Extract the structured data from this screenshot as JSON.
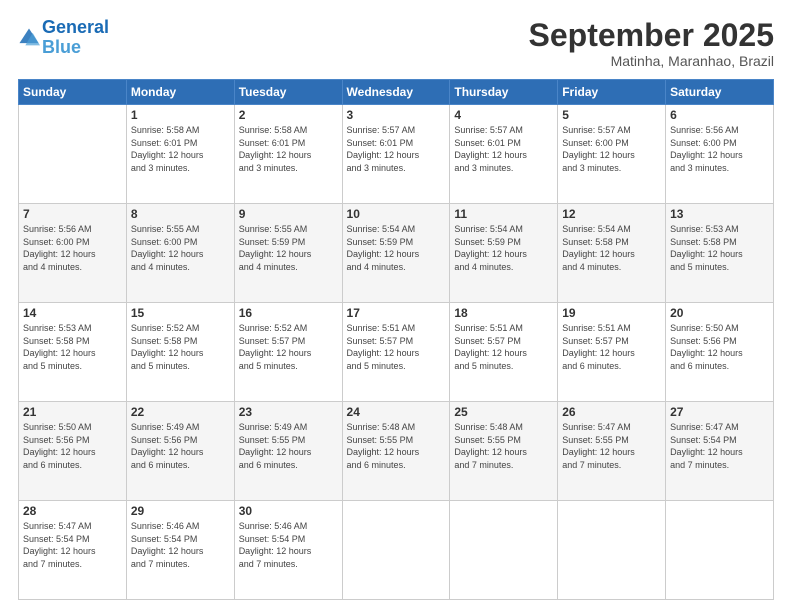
{
  "header": {
    "logo_line1": "General",
    "logo_line2": "Blue",
    "month": "September 2025",
    "location": "Matinha, Maranhao, Brazil"
  },
  "days_of_week": [
    "Sunday",
    "Monday",
    "Tuesday",
    "Wednesday",
    "Thursday",
    "Friday",
    "Saturday"
  ],
  "weeks": [
    [
      {
        "day": "",
        "info": ""
      },
      {
        "day": "1",
        "info": "Sunrise: 5:58 AM\nSunset: 6:01 PM\nDaylight: 12 hours\nand 3 minutes."
      },
      {
        "day": "2",
        "info": "Sunrise: 5:58 AM\nSunset: 6:01 PM\nDaylight: 12 hours\nand 3 minutes."
      },
      {
        "day": "3",
        "info": "Sunrise: 5:57 AM\nSunset: 6:01 PM\nDaylight: 12 hours\nand 3 minutes."
      },
      {
        "day": "4",
        "info": "Sunrise: 5:57 AM\nSunset: 6:01 PM\nDaylight: 12 hours\nand 3 minutes."
      },
      {
        "day": "5",
        "info": "Sunrise: 5:57 AM\nSunset: 6:00 PM\nDaylight: 12 hours\nand 3 minutes."
      },
      {
        "day": "6",
        "info": "Sunrise: 5:56 AM\nSunset: 6:00 PM\nDaylight: 12 hours\nand 3 minutes."
      }
    ],
    [
      {
        "day": "7",
        "info": "Sunrise: 5:56 AM\nSunset: 6:00 PM\nDaylight: 12 hours\nand 4 minutes."
      },
      {
        "day": "8",
        "info": "Sunrise: 5:55 AM\nSunset: 6:00 PM\nDaylight: 12 hours\nand 4 minutes."
      },
      {
        "day": "9",
        "info": "Sunrise: 5:55 AM\nSunset: 5:59 PM\nDaylight: 12 hours\nand 4 minutes."
      },
      {
        "day": "10",
        "info": "Sunrise: 5:54 AM\nSunset: 5:59 PM\nDaylight: 12 hours\nand 4 minutes."
      },
      {
        "day": "11",
        "info": "Sunrise: 5:54 AM\nSunset: 5:59 PM\nDaylight: 12 hours\nand 4 minutes."
      },
      {
        "day": "12",
        "info": "Sunrise: 5:54 AM\nSunset: 5:58 PM\nDaylight: 12 hours\nand 4 minutes."
      },
      {
        "day": "13",
        "info": "Sunrise: 5:53 AM\nSunset: 5:58 PM\nDaylight: 12 hours\nand 5 minutes."
      }
    ],
    [
      {
        "day": "14",
        "info": "Sunrise: 5:53 AM\nSunset: 5:58 PM\nDaylight: 12 hours\nand 5 minutes."
      },
      {
        "day": "15",
        "info": "Sunrise: 5:52 AM\nSunset: 5:58 PM\nDaylight: 12 hours\nand 5 minutes."
      },
      {
        "day": "16",
        "info": "Sunrise: 5:52 AM\nSunset: 5:57 PM\nDaylight: 12 hours\nand 5 minutes."
      },
      {
        "day": "17",
        "info": "Sunrise: 5:51 AM\nSunset: 5:57 PM\nDaylight: 12 hours\nand 5 minutes."
      },
      {
        "day": "18",
        "info": "Sunrise: 5:51 AM\nSunset: 5:57 PM\nDaylight: 12 hours\nand 5 minutes."
      },
      {
        "day": "19",
        "info": "Sunrise: 5:51 AM\nSunset: 5:57 PM\nDaylight: 12 hours\nand 6 minutes."
      },
      {
        "day": "20",
        "info": "Sunrise: 5:50 AM\nSunset: 5:56 PM\nDaylight: 12 hours\nand 6 minutes."
      }
    ],
    [
      {
        "day": "21",
        "info": "Sunrise: 5:50 AM\nSunset: 5:56 PM\nDaylight: 12 hours\nand 6 minutes."
      },
      {
        "day": "22",
        "info": "Sunrise: 5:49 AM\nSunset: 5:56 PM\nDaylight: 12 hours\nand 6 minutes."
      },
      {
        "day": "23",
        "info": "Sunrise: 5:49 AM\nSunset: 5:55 PM\nDaylight: 12 hours\nand 6 minutes."
      },
      {
        "day": "24",
        "info": "Sunrise: 5:48 AM\nSunset: 5:55 PM\nDaylight: 12 hours\nand 6 minutes."
      },
      {
        "day": "25",
        "info": "Sunrise: 5:48 AM\nSunset: 5:55 PM\nDaylight: 12 hours\nand 7 minutes."
      },
      {
        "day": "26",
        "info": "Sunrise: 5:47 AM\nSunset: 5:55 PM\nDaylight: 12 hours\nand 7 minutes."
      },
      {
        "day": "27",
        "info": "Sunrise: 5:47 AM\nSunset: 5:54 PM\nDaylight: 12 hours\nand 7 minutes."
      }
    ],
    [
      {
        "day": "28",
        "info": "Sunrise: 5:47 AM\nSunset: 5:54 PM\nDaylight: 12 hours\nand 7 minutes."
      },
      {
        "day": "29",
        "info": "Sunrise: 5:46 AM\nSunset: 5:54 PM\nDaylight: 12 hours\nand 7 minutes."
      },
      {
        "day": "30",
        "info": "Sunrise: 5:46 AM\nSunset: 5:54 PM\nDaylight: 12 hours\nand 7 minutes."
      },
      {
        "day": "",
        "info": ""
      },
      {
        "day": "",
        "info": ""
      },
      {
        "day": "",
        "info": ""
      },
      {
        "day": "",
        "info": ""
      }
    ]
  ]
}
